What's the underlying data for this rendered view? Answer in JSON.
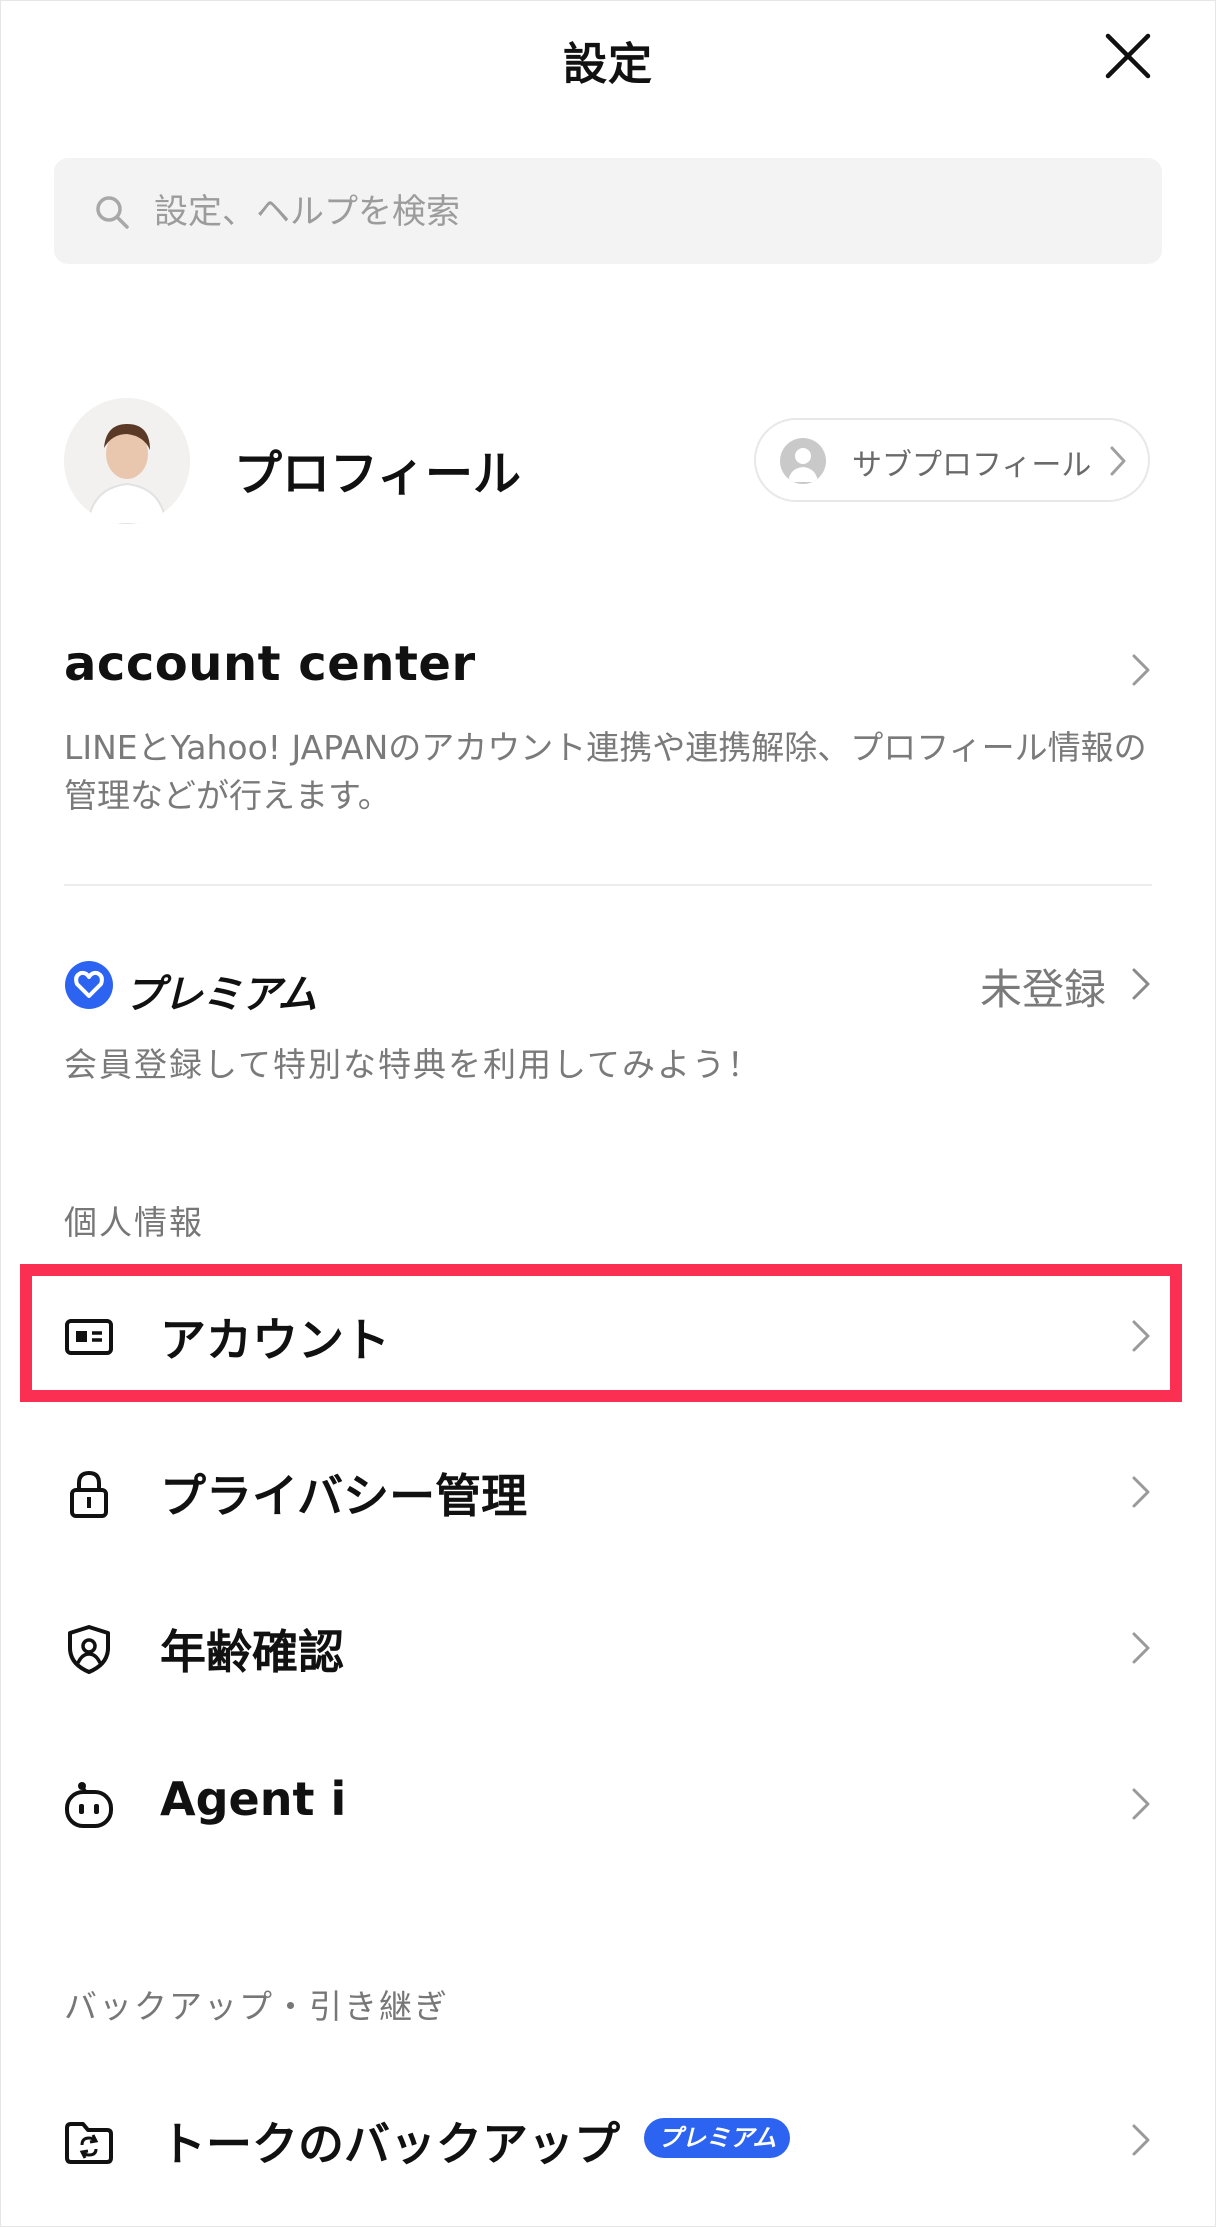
{
  "header": {
    "title": "設定"
  },
  "search": {
    "placeholder": "設定、ヘルプを検索"
  },
  "profile": {
    "name": "プロフィール",
    "subprofile_label": "サブプロフィール"
  },
  "account_center": {
    "title": "account center",
    "description": "LINEとYahoo! JAPANのアカウント連携や連携解除、プロフィール情報の管理などが行えます。"
  },
  "premium": {
    "label": "プレミアム",
    "status": "未登録",
    "description": "会員登録して特別な特典を利用してみよう！"
  },
  "sections": {
    "personal": {
      "title": "個人情報",
      "items": [
        {
          "label": "アカウント",
          "icon": "id-card-icon",
          "highlighted": true
        },
        {
          "label": "プライバシー管理",
          "icon": "lock-icon"
        },
        {
          "label": "年齢確認",
          "icon": "age-verification-shield-icon"
        },
        {
          "label": "Agent i",
          "icon": "robot-icon"
        }
      ]
    },
    "backup": {
      "title": "バックアップ・引き継ぎ",
      "items": [
        {
          "label": "トークのバックアップ",
          "icon": "folder-sync-icon",
          "badge": "プレミアム"
        }
      ]
    }
  },
  "colors": {
    "accent_blue": "#2c63f0",
    "highlight_red": "#fb2f52",
    "muted_text": "#7a7a7a"
  }
}
